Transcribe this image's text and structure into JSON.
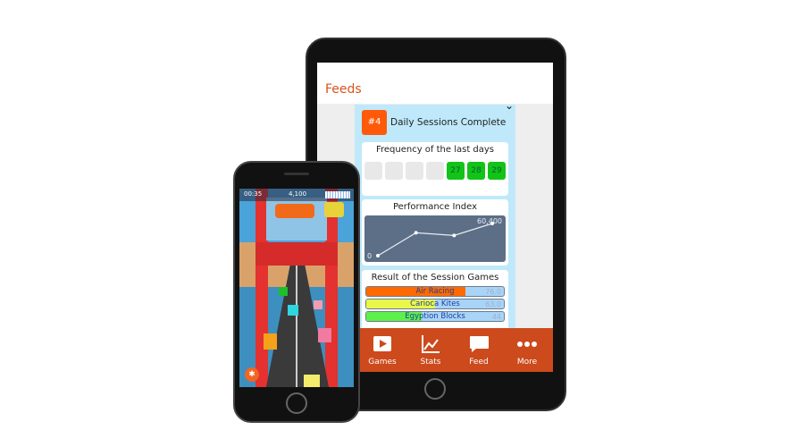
{
  "tablet": {
    "header": {
      "title": "Feeds"
    },
    "feed_card": {
      "rank": "#4",
      "title": "Daily Sessions Complete",
      "frequency": {
        "title": "Frequency of the last days",
        "days": [
          "",
          "",
          "",
          "",
          "27",
          "28",
          "29"
        ],
        "active": [
          false,
          false,
          false,
          false,
          true,
          true,
          true
        ]
      },
      "performance": {
        "title": "Performance Index",
        "max_label": "60,400",
        "min_label": "0",
        "points": [
          0,
          43000,
          38000,
          60400
        ]
      },
      "results": {
        "title": "Result of the Session Games",
        "games": [
          {
            "name": "Air Racing",
            "value": "76.0",
            "color": "#ff6a00",
            "fill": 0.72
          },
          {
            "name": "Carioca Kites",
            "value": "63.0",
            "color": "#e9f74a",
            "fill": 0.5
          },
          {
            "name": "Egyption Blocks",
            "value": "44",
            "color": "#5df04a",
            "fill": 0.4
          }
        ]
      }
    },
    "tabbar": [
      {
        "label": "Games",
        "icon": "play-icon"
      },
      {
        "label": "Stats",
        "icon": "chart-icon"
      },
      {
        "label": "Feed",
        "icon": "speech-bubble-icon"
      },
      {
        "label": "More",
        "icon": "more-dots-icon"
      }
    ]
  },
  "phone": {
    "game": {
      "timer": "00:35",
      "score": "4,100",
      "power_icon": "runner-icon"
    }
  }
}
